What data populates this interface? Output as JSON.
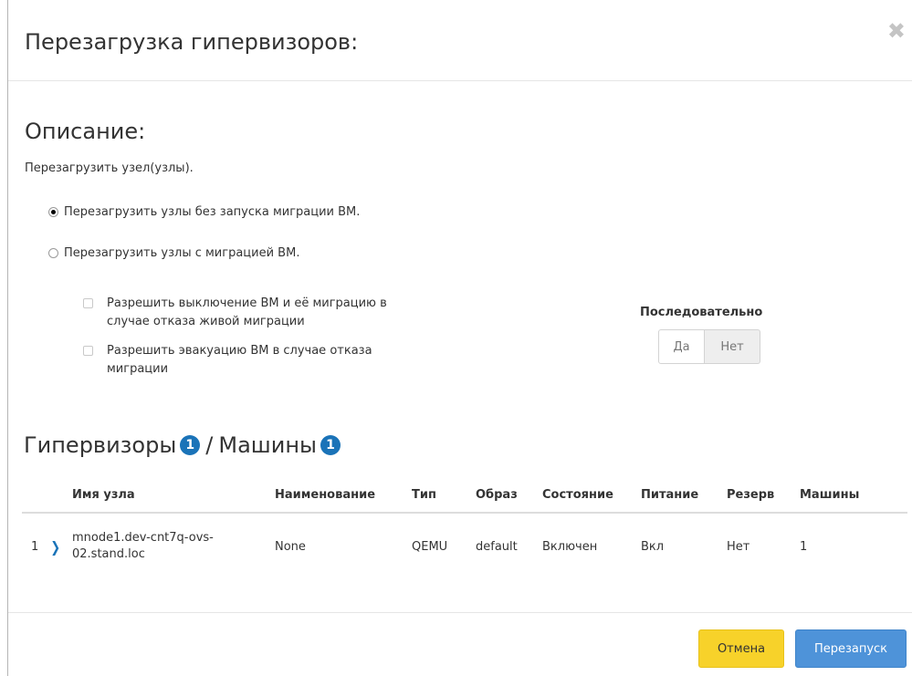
{
  "modal": {
    "title": "Перезагрузка гипервизоров:",
    "close_icon": "close-icon"
  },
  "description": {
    "heading": "Описание:",
    "text": "Перезагрузить узел(узлы)."
  },
  "options": {
    "radio_no_migration": {
      "label": "Перезагрузить узлы без запуска миграции ВМ.",
      "checked": true
    },
    "radio_with_migration": {
      "label": "Перезагрузить узлы с миграцией ВМ.",
      "checked": false
    },
    "check_allow_shutdown": {
      "label_line1": "Разрешить выключение ВМ и её миграцию в",
      "label_line2": "случае отказа живой миграции",
      "checked": false
    },
    "check_allow_evacuation": {
      "label_line1": "Разрешить эвакуацию ВМ в случае отказа",
      "label_line2": "миграции",
      "checked": false
    }
  },
  "sequential": {
    "label": "Последовательно",
    "yes": "Да",
    "no": "Нет",
    "selected": "Нет"
  },
  "hypervisors": {
    "title": "Гипервизоры",
    "count": "1",
    "separator": "/",
    "machines_title": "Машины",
    "machines_count": "1",
    "columns": [
      "Имя узла",
      "Наименование",
      "Тип",
      "Образ",
      "Состояние",
      "Питание",
      "Резерв",
      "Машины"
    ],
    "rows": [
      {
        "num": "1",
        "name_line1": "mnode1.dev-cnt7q-ovs-",
        "name_line2": "02.stand.loc",
        "title": "None",
        "type": "QEMU",
        "image": "default",
        "state": "Включен",
        "power": "Вкл",
        "reserve": "Нет",
        "machines": "1"
      }
    ]
  },
  "footer": {
    "cancel": "Отмена",
    "restart": "Перезапуск"
  },
  "colors": {
    "accent_blue": "#1a73b8",
    "cancel_yellow": "#f7d22a",
    "restart_blue": "#4e93d9"
  }
}
